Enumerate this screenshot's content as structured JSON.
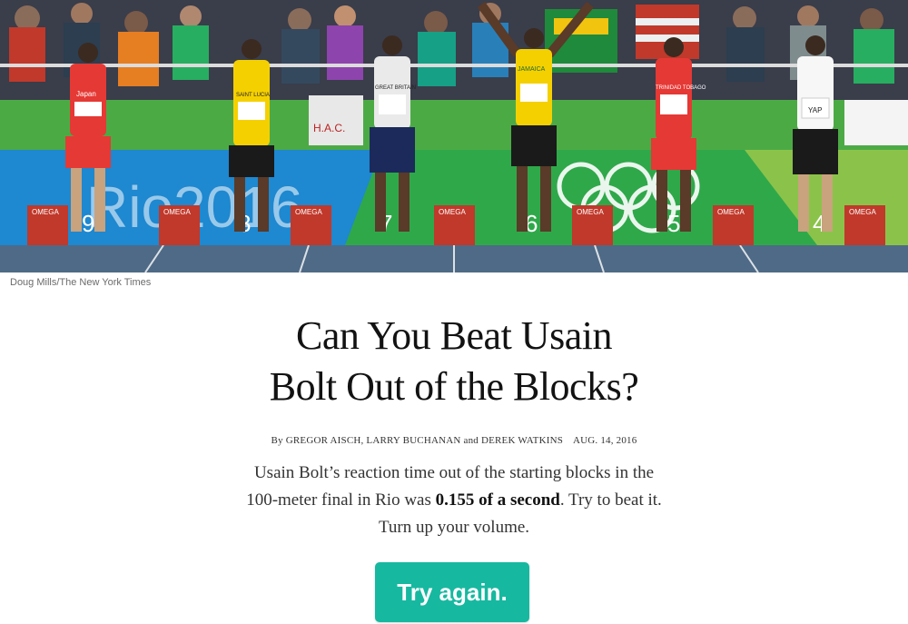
{
  "photo": {
    "credit": "Doug Mills/The New York Times",
    "banner_text": "Rio2016",
    "block_brand": "OMEGA",
    "bibs": [
      "Japan",
      "SAINT LUCIA",
      "GREAT BRITAIN",
      "JAMAICA",
      "TRINIDAD TOBAGO",
      "YAP"
    ],
    "lane_numbers": [
      "9",
      "8",
      "7",
      "6",
      "5",
      "4"
    ],
    "sign_text": "H.A.C."
  },
  "article": {
    "headline_lines": [
      "Can You Beat Usain",
      "Bolt Out of the Blocks?"
    ],
    "byline": "By GREGOR AISCH, LARRY BUCHANAN and DEREK WATKINS",
    "date": "AUG. 14, 2016",
    "summary_line1": "Usain Bolt’s reaction time out of the starting blocks in the",
    "summary_line2_pre": "100-meter final in Rio was ",
    "summary_line2_bold": "0.155 of a second",
    "summary_line2_post": ". Try to beat it.",
    "summary_line3": "Turn up your volume."
  },
  "cta": {
    "label": "Try again."
  },
  "colors": {
    "accent": "#17b8a0",
    "track": "#4f6a86",
    "banner_green": "#2fa84a",
    "banner_blue": "#1e88d0"
  }
}
